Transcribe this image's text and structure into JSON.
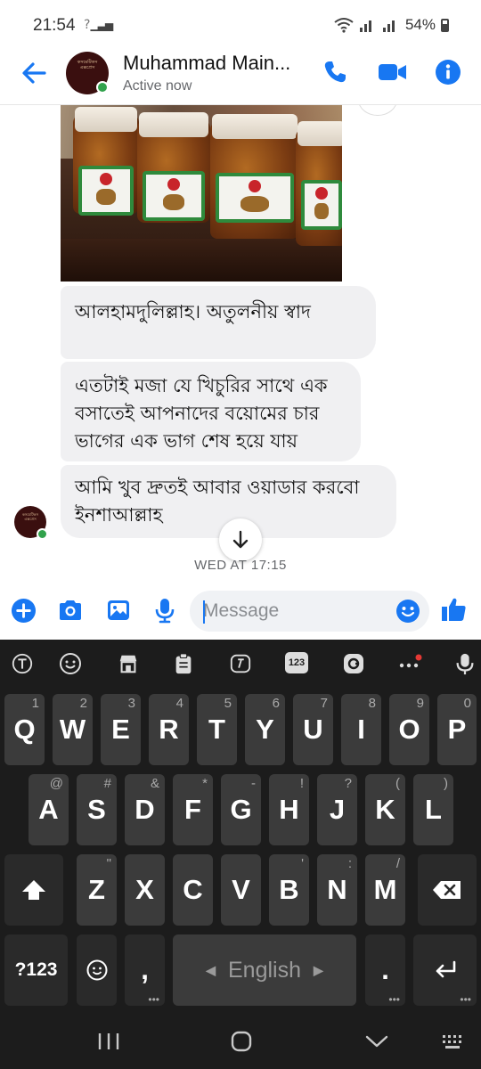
{
  "status_bar": {
    "time": "21:54",
    "network_label": "?",
    "battery": "54%"
  },
  "header": {
    "contact_name": "Muhammad Main...",
    "contact_status": "Active now",
    "avatar_text": "কসমেটিকস এক্সপ্রেস"
  },
  "messages": [
    {
      "text": "আলহামদুলিল্লাহ। অতুলনীয় স্বাদ"
    },
    {
      "lines": [
        "এতটাই মজা যে খিচুরির সাথে এক",
        "বসাতেই আপনাদের বয়োমের চার",
        "ভাগের এক ভাগ শেষ হয়ে যায়"
      ]
    },
    {
      "lines": [
        "আমি খুব দ্রুতই আবার ওয়াডার করবো",
        "ইনশাআল্লাহ"
      ]
    }
  ],
  "timestamp": "WED AT 17:15",
  "composer": {
    "placeholder": "Message"
  },
  "keyboard": {
    "row1": [
      {
        "key": "Q",
        "hint": "1"
      },
      {
        "key": "W",
        "hint": "2"
      },
      {
        "key": "E",
        "hint": "3"
      },
      {
        "key": "R",
        "hint": "4"
      },
      {
        "key": "T",
        "hint": "5"
      },
      {
        "key": "Y",
        "hint": "6"
      },
      {
        "key": "U",
        "hint": "7"
      },
      {
        "key": "I",
        "hint": "8"
      },
      {
        "key": "O",
        "hint": "9"
      },
      {
        "key": "P",
        "hint": "0"
      }
    ],
    "row2": [
      {
        "key": "A",
        "hint": "@"
      },
      {
        "key": "S",
        "hint": "#"
      },
      {
        "key": "D",
        "hint": "&"
      },
      {
        "key": "F",
        "hint": "*"
      },
      {
        "key": "G",
        "hint": "-"
      },
      {
        "key": "H",
        "hint": "!"
      },
      {
        "key": "J",
        "hint": "?"
      },
      {
        "key": "K",
        "hint": "("
      },
      {
        "key": "L",
        "hint": ")"
      }
    ],
    "row3": [
      {
        "key": "Z",
        "hint": "\""
      },
      {
        "key": "X",
        "hint": ""
      },
      {
        "key": "C",
        "hint": ""
      },
      {
        "key": "V",
        "hint": ""
      },
      {
        "key": "B",
        "hint": "'"
      },
      {
        "key": "N",
        "hint": ":"
      },
      {
        "key": "M",
        "hint": "/"
      }
    ],
    "symbols_key": "?123",
    "comma_key": ",",
    "period_key": ".",
    "space_label": "English",
    "toolbar_123": "123"
  },
  "colors": {
    "accent": "#1877f2",
    "online": "#31a24c",
    "bubble": "#f0f0f2",
    "keyboard_bg": "#1c1c1c",
    "key_bg": "#3b3b3b"
  }
}
